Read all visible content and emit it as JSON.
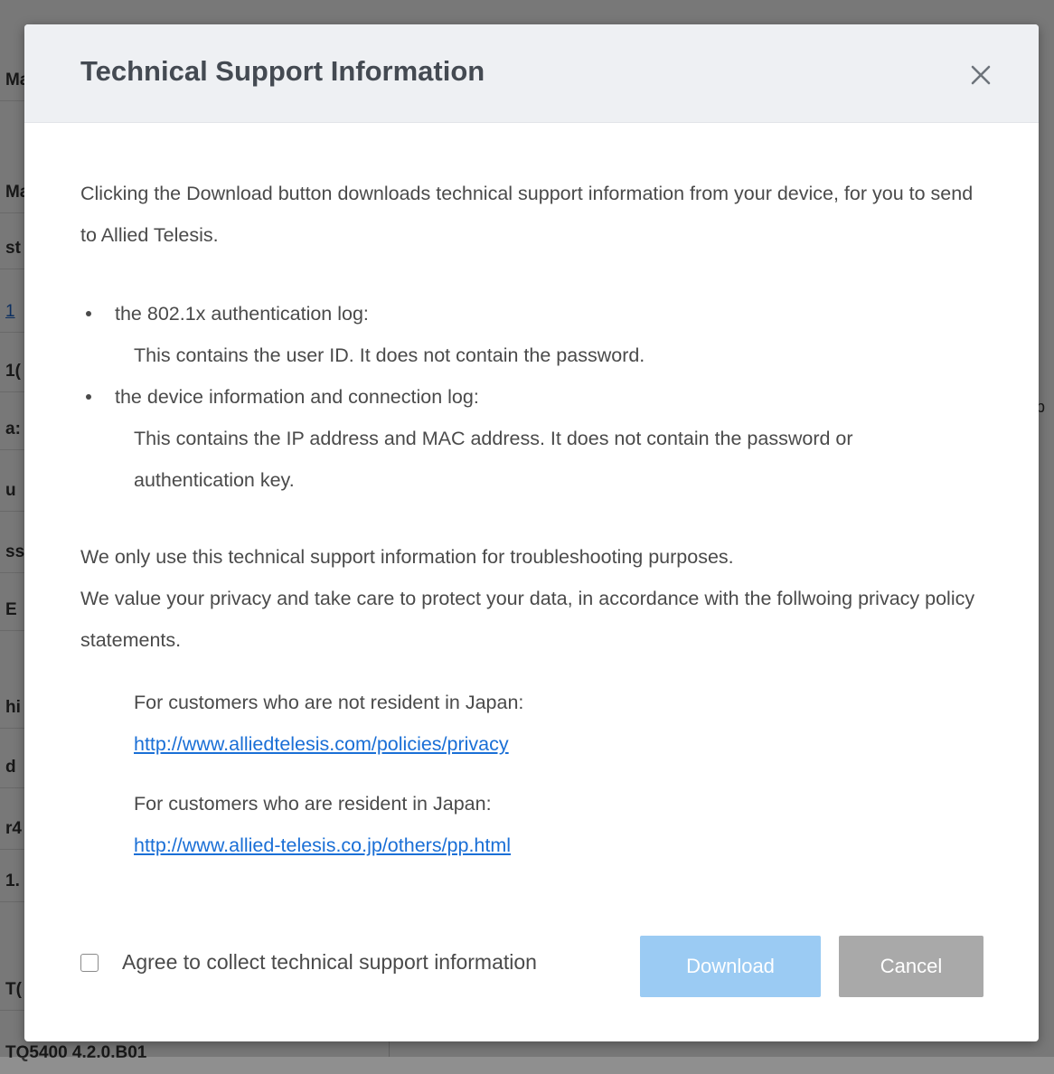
{
  "background": {
    "rows": [
      {
        "text": "Ma"
      },
      {
        "text": "st"
      },
      {
        "text": "1"
      },
      {
        "text": "1("
      },
      {
        "text": "a:"
      },
      {
        "text": "u"
      },
      {
        "text": "ss"
      },
      {
        "text": "E"
      },
      {
        "text": "hi"
      },
      {
        "text": "d"
      },
      {
        "text": "r4"
      },
      {
        "text": "1."
      },
      {
        "text": "T("
      },
      {
        "text": "TQ5400 4.2.0.B01"
      }
    ],
    "right_fragment": "p"
  },
  "modal": {
    "title": "Technical Support Information",
    "close_icon": "close-icon",
    "intro": "Clicking the Download button downloads technical support information from your device, for you to send to Allied Telesis.",
    "bullets": [
      {
        "head": "the 802.1x authentication log:",
        "desc": "This contains the user ID. It does not contain the password."
      },
      {
        "head": "the device information and connection log:",
        "desc": "This contains the IP address and MAC address. It does not contain the password or authentication key."
      }
    ],
    "privacy_line1": "We only use this technical support information for troubleshooting purposes.",
    "privacy_line2": "We value your privacy and take care to protect your data, in accordance with the follwoing privacy policy statements.",
    "policies": [
      {
        "label": "For customers who are not resident in Japan:",
        "link": "http://www.alliedtelesis.com/policies/privacy"
      },
      {
        "label": "For customers who are resident in Japan:",
        "link": "http://www.allied-telesis.co.jp/others/pp.html"
      }
    ],
    "agree_label": "Agree to collect technical support information",
    "agree_checked": false,
    "download_label": "Download",
    "cancel_label": "Cancel",
    "colors": {
      "header_bg": "#eef0f3",
      "link": "#1a6fd6",
      "download_disabled": "#9bcbf3",
      "cancel": "#a9a9a9"
    }
  }
}
